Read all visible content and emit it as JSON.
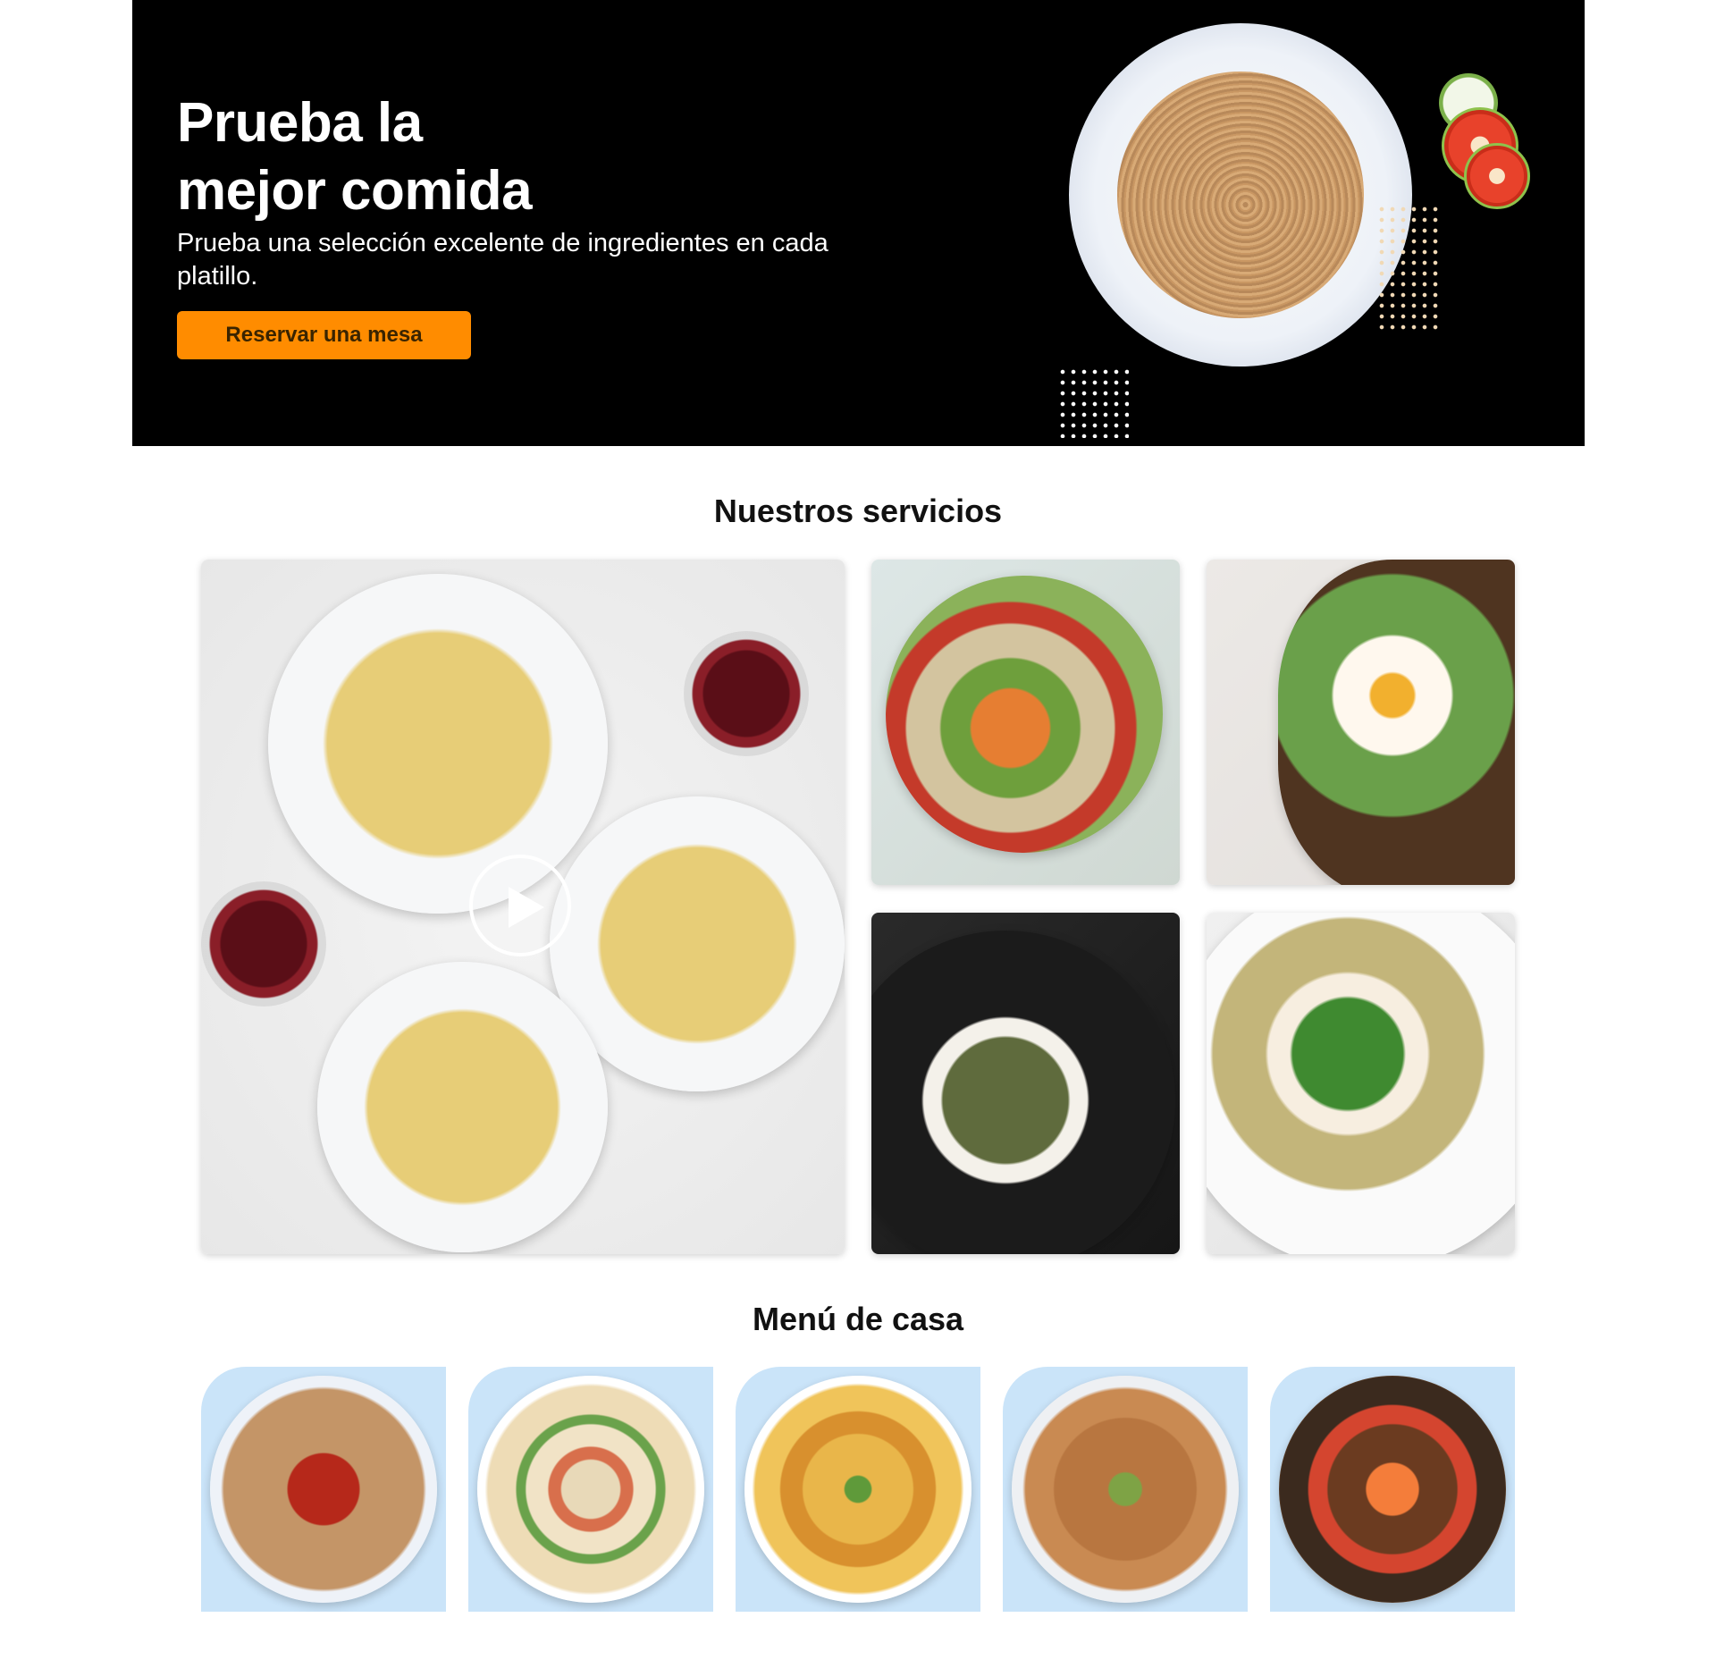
{
  "hero": {
    "title_line1": "Prueba la",
    "title_line2": "mejor comida",
    "subtitle": "Prueba una selección excelente de ingredientes en cada platillo.",
    "cta_label": "Reservar una mesa",
    "image": "spaghetti-plate"
  },
  "services": {
    "title": "Nuestros servicios",
    "cards": [
      {
        "image": "pasta-dinner-table",
        "has_video": true,
        "icon": "play-icon"
      },
      {
        "image": "roasted-vegetable-bowl"
      },
      {
        "image": "avocado-egg-toast"
      },
      {
        "image": "asparagus-poached-egg"
      },
      {
        "image": "spinach-egg-toast"
      }
    ]
  },
  "menu": {
    "title": "Menú de casa",
    "items": [
      {
        "image": "spaghetti-plate"
      },
      {
        "image": "penne-pasta-salad"
      },
      {
        "image": "fusilli-pasta"
      },
      {
        "image": "noodles-with-avocado"
      },
      {
        "image": "rice-bowl"
      }
    ]
  },
  "colors": {
    "hero_background": "#000000",
    "cta_background": "#ff8c00",
    "menu_card_background": "#cae4f9",
    "dots_right": "#f1d9b5",
    "dots_bottom": "#ffffff"
  }
}
